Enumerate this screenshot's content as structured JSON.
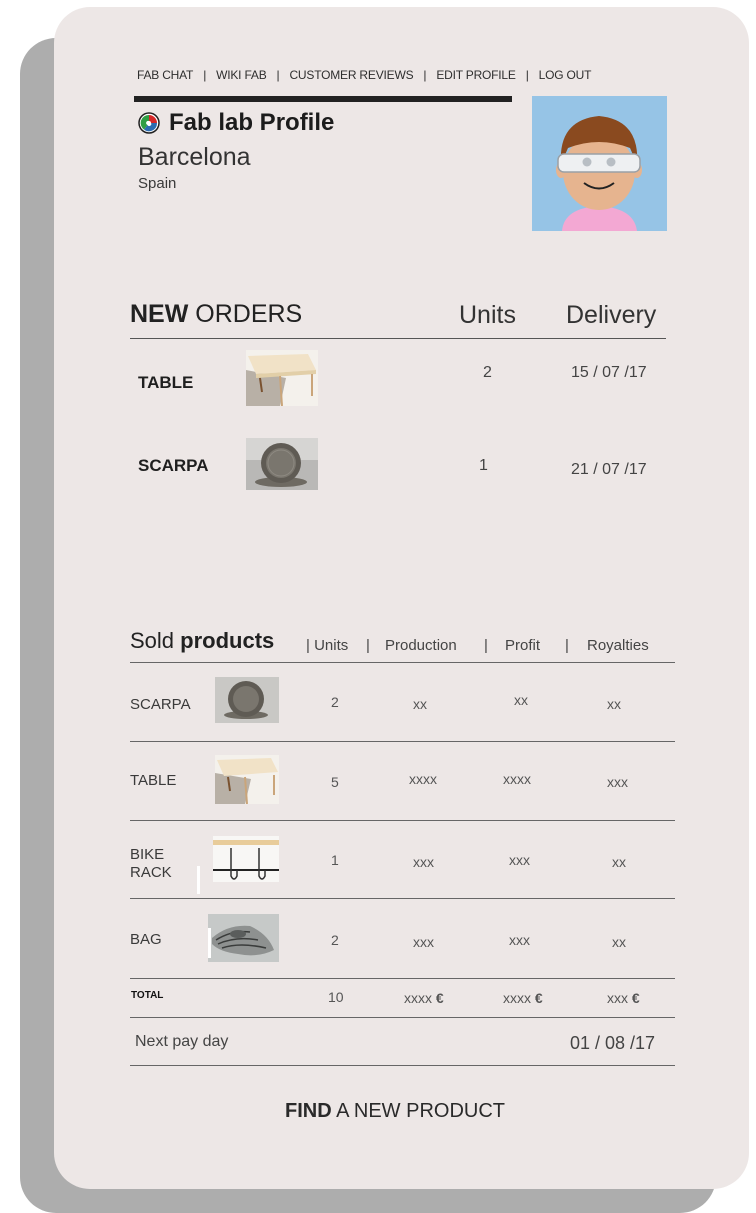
{
  "nav": {
    "items": [
      "FAB CHAT",
      "WIKI FAB",
      "CUSTOMER REVIEWS",
      "EDIT PROFILE",
      "LOG OUT"
    ],
    "separator": "|"
  },
  "profile": {
    "title": "Fab lab Profile",
    "logo_icon": "fab-lab-logo-icon",
    "city": "Barcelona",
    "country": "Spain",
    "avatar_icon": "avatar-with-glasses"
  },
  "new_orders": {
    "title_bold": "NEW",
    "title_rest": " ORDERS",
    "col_units": "Units",
    "col_delivery": "Delivery",
    "rows": [
      {
        "name": "TABLE",
        "thumb": "table-thumb",
        "units": "2",
        "delivery": "15 / 07 /17"
      },
      {
        "name": "SCARPA",
        "thumb": "scarpa-thumb",
        "units": "1",
        "delivery": "21 / 07 /17"
      }
    ]
  },
  "sold_products": {
    "title_plain": "Sold ",
    "title_bold": "products",
    "columns": [
      "| Units",
      "|",
      "Production",
      "|",
      "Profit",
      "|",
      "Royalties"
    ],
    "rows": [
      {
        "name": "SCARPA",
        "thumb": "scarpa-thumb",
        "units": "2",
        "production": "xx",
        "profit": "xx",
        "royalties": "xx"
      },
      {
        "name": "TABLE",
        "thumb": "table-thumb",
        "units": "5",
        "production": "xxxx",
        "profit": "xxxx",
        "royalties": "xxx"
      },
      {
        "name": "BIKE",
        "name2": "RACK",
        "thumb": "bike-rack-thumb",
        "units": "1",
        "production": "xxx",
        "profit": "xxx",
        "royalties": "xx"
      },
      {
        "name": "BAG",
        "thumb": "bag-thumb",
        "units": "2",
        "production": "xxx",
        "profit": "xxx",
        "royalties": "xx"
      }
    ],
    "total": {
      "label": "TOTAL",
      "units": "10",
      "production": "xxxx",
      "profit": "xxxx",
      "royalties": "xxx",
      "currency": "€"
    }
  },
  "next_pay": {
    "label": "Next pay day",
    "date": "01 / 08 /17"
  },
  "find_button": {
    "bold": "FIND",
    "rest": " A NEW PRODUCT"
  }
}
